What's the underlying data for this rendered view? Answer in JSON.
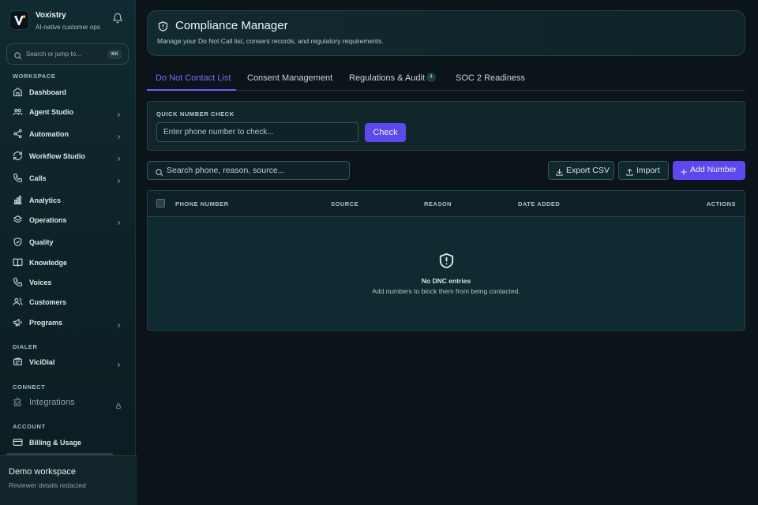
{
  "brand": {
    "name": "Voxistry",
    "tagline": "AI-native customer ops"
  },
  "sidebar": {
    "search_placeholder": "Search or jump to...",
    "search_shortcut": "⌘K",
    "sections": {
      "workspace": "WORKSPACE",
      "dialer": "DIALER",
      "connect": "CONNECT",
      "account": "ACCOUNT"
    },
    "items": [
      {
        "label": "Dashboard",
        "icon": "home-icon",
        "has_children": false
      },
      {
        "label": "Agent Studio",
        "icon": "agents-icon",
        "has_children": true
      },
      {
        "label": "Automation",
        "icon": "share-icon",
        "has_children": true
      },
      {
        "label": "Workflow Studio",
        "icon": "refresh-icon",
        "has_children": true
      },
      {
        "label": "Calls",
        "icon": "phone-icon",
        "has_children": true
      },
      {
        "label": "Analytics",
        "icon": "bar-chart-icon",
        "has_children": false
      },
      {
        "label": "Operations",
        "icon": "layers-icon",
        "has_children": true
      },
      {
        "label": "Quality",
        "icon": "shield-check-icon",
        "has_children": false
      },
      {
        "label": "Knowledge",
        "icon": "book-icon",
        "has_children": false
      },
      {
        "label": "Voices",
        "icon": "phone-outline-icon",
        "has_children": false
      },
      {
        "label": "Customers",
        "icon": "users-icon",
        "has_children": false
      },
      {
        "label": "Programs",
        "icon": "megaphone-icon",
        "has_children": true
      },
      {
        "label": "ViciDial",
        "icon": "dialer-icon",
        "has_children": true
      },
      {
        "label": "Integrations",
        "icon": "puzzle-icon",
        "locked": true
      },
      {
        "label": "Billing & Usage",
        "icon": "credit-card-icon",
        "has_children": false
      }
    ],
    "workspace": {
      "name": "Demo workspace",
      "subtitle": "Reviewer details redacted"
    }
  },
  "header": {
    "title": "Compliance Manager",
    "description": "Manage your Do Not Call list, consent records, and regulatory requirements."
  },
  "tabs": [
    {
      "label": "Do Not Contact List",
      "active": true
    },
    {
      "label": "Consent Management",
      "active": false
    },
    {
      "label": "Regulations & Audit",
      "active": false,
      "badge": "4"
    },
    {
      "label": "SOC 2 Readiness",
      "active": false
    }
  ],
  "quick_check": {
    "label": "QUICK NUMBER CHECK",
    "placeholder": "Enter phone number to check...",
    "button": "Check"
  },
  "toolbar": {
    "search_placeholder": "Search phone, reason, source...",
    "export_label": "Export CSV",
    "import_label": "Import",
    "add_label": "Add Number"
  },
  "table": {
    "columns": [
      "PHONE NUMBER",
      "SOURCE",
      "REASON",
      "DATE ADDED",
      "ACTIONS"
    ],
    "rows": [],
    "empty_title": "No DNC entries",
    "empty_subtitle": "Add numbers to block them from being contacted."
  },
  "colors": {
    "accent": "#5c47f0",
    "active_tab": "#7a6cf7",
    "background": "#0b1419",
    "sidebar": "#0f2a30"
  }
}
